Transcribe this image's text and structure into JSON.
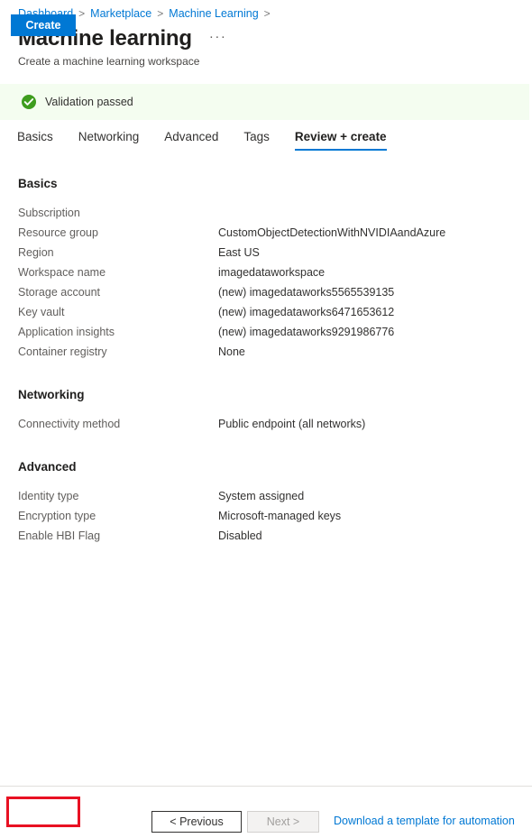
{
  "breadcrumb": {
    "items": [
      "Dashboard",
      "Marketplace",
      "Machine Learning"
    ],
    "separator": ">",
    "trailing_separator": ">"
  },
  "header": {
    "title": "Machine learning",
    "subtitle": "Create a machine learning workspace",
    "more_actions": "···"
  },
  "validation": {
    "message": "Validation passed",
    "icon": "check-circle-icon",
    "background": "#f4fdf0",
    "icon_color": "#107c10"
  },
  "tabs": [
    {
      "label": "Basics",
      "active": false
    },
    {
      "label": "Networking",
      "active": false
    },
    {
      "label": "Advanced",
      "active": false
    },
    {
      "label": "Tags",
      "active": false
    },
    {
      "label": "Review + create",
      "active": true
    }
  ],
  "sections": [
    {
      "title": "Basics",
      "rows": [
        {
          "key": "Subscription",
          "value": ""
        },
        {
          "key": "Resource group",
          "value": "CustomObjectDetectionWithNVIDIAandAzure"
        },
        {
          "key": "Region",
          "value": "East US"
        },
        {
          "key": "Workspace name",
          "value": "imagedataworkspace"
        },
        {
          "key": "Storage account",
          "value": "(new) imagedataworks5565539135"
        },
        {
          "key": "Key vault",
          "value": "(new) imagedataworks6471653612"
        },
        {
          "key": "Application insights",
          "value": "(new) imagedataworks9291986776"
        },
        {
          "key": "Container registry",
          "value": "None"
        }
      ]
    },
    {
      "title": "Networking",
      "rows": [
        {
          "key": "Connectivity method",
          "value": "Public endpoint (all networks)"
        }
      ]
    },
    {
      "title": "Advanced",
      "rows": [
        {
          "key": "Identity type",
          "value": "System assigned"
        },
        {
          "key": "Encryption type",
          "value": "Microsoft-managed keys"
        },
        {
          "key": "Enable HBI Flag",
          "value": "Disabled"
        }
      ]
    }
  ],
  "footer": {
    "create_label": "Create",
    "previous_label": "< Previous",
    "next_label": "Next >",
    "download_label": "Download a template for automation",
    "highlight_color": "#e81123",
    "primary_color": "#0078d4"
  }
}
